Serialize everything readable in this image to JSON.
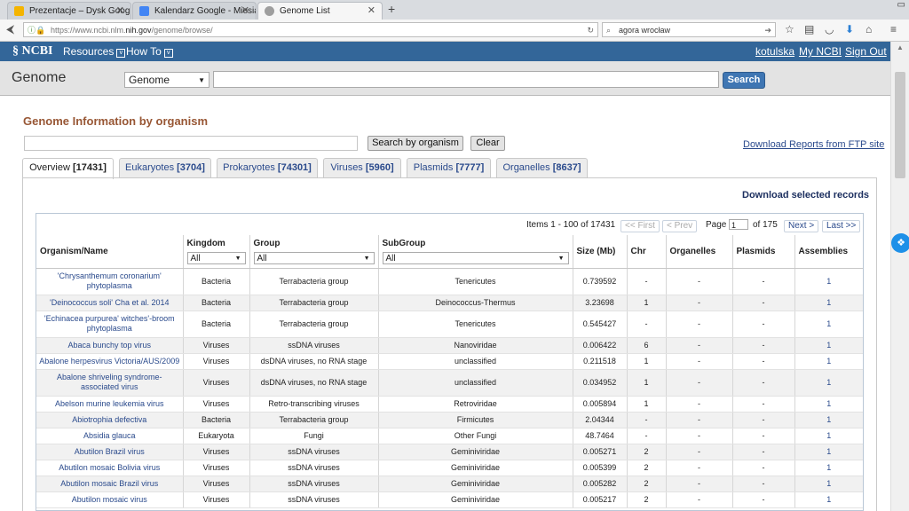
{
  "browser": {
    "tabs": [
      {
        "title": "Prezentacje – Dysk Google",
        "favicon_color": "#f4b400"
      },
      {
        "title": "Kalendarz Google - Miesią…",
        "favicon_color": "#4285f4"
      },
      {
        "title": "Genome List",
        "favicon_color": "#9e9e9e"
      }
    ],
    "url_prefix": "https://www.ncbi.nlm.",
    "url_domain": "nih.gov",
    "url_suffix": "/genome/browse/",
    "search_value": "agora wrocław"
  },
  "ncbi": {
    "logo": "NCBI",
    "menu_resources": "Resources",
    "menu_howto": "How To",
    "user": "kotulska",
    "my_ncbi": "My NCBI",
    "sign_out": "Sign Out"
  },
  "search": {
    "title": "Genome",
    "db_value": "Genome",
    "term_value": "",
    "button": "Search"
  },
  "page": {
    "heading": "Genome Information by organism",
    "organism_value": "",
    "search_by_organism": "Search by organism",
    "clear": "Clear",
    "ftp_link": "Download Reports from FTP site",
    "download_selected": "Download selected records"
  },
  "tabs": [
    {
      "label": "Overview",
      "count": "[17431]"
    },
    {
      "label": "Eukaryotes",
      "count": "[3704]"
    },
    {
      "label": "Prokaryotes",
      "count": "[74301]"
    },
    {
      "label": "Viruses",
      "count": "[5960]"
    },
    {
      "label": "Plasmids",
      "count": "[7777]"
    },
    {
      "label": "Organelles",
      "count": "[8637]"
    }
  ],
  "pager": {
    "items": "Items 1 - 100 of 17431",
    "first": "<< First",
    "prev": "< Prev",
    "page_label": "Page",
    "page_value": "1",
    "of_pages": "of 175",
    "next": "Next >",
    "last": "Last >>"
  },
  "columns": {
    "organism": "Organism/Name",
    "kingdom": "Kingdom",
    "group": "Group",
    "subgroup": "SubGroup",
    "size": "Size (Mb)",
    "chr": "Chr",
    "organelles": "Organelles",
    "plasmids": "Plasmids",
    "assemblies": "Assemblies"
  },
  "filters": {
    "kingdom": "All",
    "group": "All",
    "subgroup": "All"
  },
  "rows": [
    {
      "name": "'Chrysanthemum coronarium' phytoplasma",
      "kingdom": "Bacteria",
      "group": "Terrabacteria group",
      "subgroup": "Tenericutes",
      "size": "0.739592",
      "chr": "-",
      "organelles": "-",
      "plasmids": "-",
      "assemblies": "1"
    },
    {
      "name": "'Deinococcus soli' Cha et al. 2014",
      "kingdom": "Bacteria",
      "group": "Terrabacteria group",
      "subgroup": "Deinococcus-Thermus",
      "size": "3.23698",
      "chr": "1",
      "organelles": "-",
      "plasmids": "-",
      "assemblies": "1"
    },
    {
      "name": "'Echinacea purpurea' witches'-broom phytoplasma",
      "kingdom": "Bacteria",
      "group": "Terrabacteria group",
      "subgroup": "Tenericutes",
      "size": "0.545427",
      "chr": "-",
      "organelles": "-",
      "plasmids": "-",
      "assemblies": "1"
    },
    {
      "name": "Abaca bunchy top virus",
      "kingdom": "Viruses",
      "group": "ssDNA viruses",
      "subgroup": "Nanoviridae",
      "size": "0.006422",
      "chr": "6",
      "organelles": "-",
      "plasmids": "-",
      "assemblies": "1"
    },
    {
      "name": "Abalone herpesvirus Victoria/AUS/2009",
      "kingdom": "Viruses",
      "group": "dsDNA viruses, no RNA stage",
      "subgroup": "unclassified",
      "size": "0.211518",
      "chr": "1",
      "organelles": "-",
      "plasmids": "-",
      "assemblies": "1"
    },
    {
      "name": "Abalone shriveling syndrome-associated virus",
      "kingdom": "Viruses",
      "group": "dsDNA viruses, no RNA stage",
      "subgroup": "unclassified",
      "size": "0.034952",
      "chr": "1",
      "organelles": "-",
      "plasmids": "-",
      "assemblies": "1"
    },
    {
      "name": "Abelson murine leukemia virus",
      "kingdom": "Viruses",
      "group": "Retro-transcribing viruses",
      "subgroup": "Retroviridae",
      "size": "0.005894",
      "chr": "1",
      "organelles": "-",
      "plasmids": "-",
      "assemblies": "1"
    },
    {
      "name": "Abiotrophia defectiva",
      "kingdom": "Bacteria",
      "group": "Terrabacteria group",
      "subgroup": "Firmicutes",
      "size": "2.04344",
      "chr": "-",
      "organelles": "-",
      "plasmids": "-",
      "assemblies": "1"
    },
    {
      "name": "Absidia glauca",
      "kingdom": "Eukaryota",
      "group": "Fungi",
      "subgroup": "Other Fungi",
      "size": "48.7464",
      "chr": "-",
      "organelles": "-",
      "plasmids": "-",
      "assemblies": "1"
    },
    {
      "name": "Abutilon Brazil virus",
      "kingdom": "Viruses",
      "group": "ssDNA viruses",
      "subgroup": "Geminiviridae",
      "size": "0.005271",
      "chr": "2",
      "organelles": "-",
      "plasmids": "-",
      "assemblies": "1"
    },
    {
      "name": "Abutilon mosaic Bolivia virus",
      "kingdom": "Viruses",
      "group": "ssDNA viruses",
      "subgroup": "Geminiviridae",
      "size": "0.005399",
      "chr": "2",
      "organelles": "-",
      "plasmids": "-",
      "assemblies": "1"
    },
    {
      "name": "Abutilon mosaic Brazil virus",
      "kingdom": "Viruses",
      "group": "ssDNA viruses",
      "subgroup": "Geminiviridae",
      "size": "0.005282",
      "chr": "2",
      "organelles": "-",
      "plasmids": "-",
      "assemblies": "1"
    },
    {
      "name": "Abutilon mosaic virus",
      "kingdom": "Viruses",
      "group": "ssDNA viruses",
      "subgroup": "Geminiviridae",
      "size": "0.005217",
      "chr": "2",
      "organelles": "-",
      "plasmids": "-",
      "assemblies": "1"
    }
  ]
}
